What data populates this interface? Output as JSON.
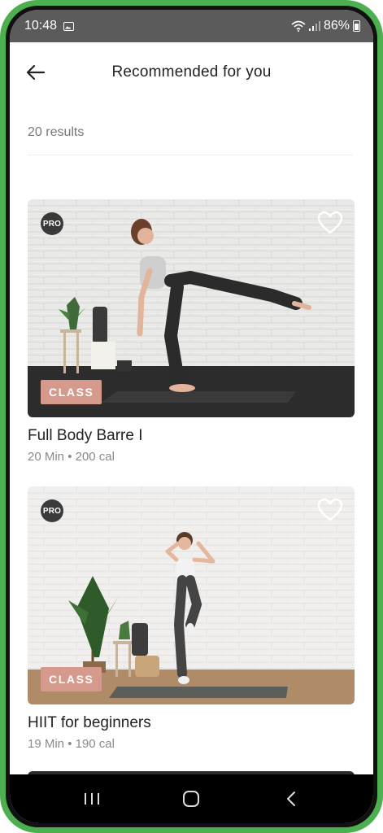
{
  "status_bar": {
    "time": "10:48",
    "battery": "86%"
  },
  "header": {
    "title": "Recommended for you"
  },
  "results_count": "20 results",
  "cards": [
    {
      "badge_pro": "PRO",
      "tag": "CLASS",
      "name": "Full Body Barre I",
      "meta": "20 Min • 200 cal"
    },
    {
      "badge_pro": "PRO",
      "tag": "CLASS",
      "name": "HIIT for beginners",
      "meta": "19 Min • 190 cal"
    }
  ],
  "icons": {
    "back": "arrow-left-icon",
    "favorite": "heart-outline-icon",
    "nav_recents": "recents-icon",
    "nav_home": "home-icon",
    "nav_back": "back-chevron-icon"
  },
  "colors": {
    "frame": "#4caf50",
    "class_tag": "#d59a8c",
    "status_bar": "#5b5b5b"
  }
}
